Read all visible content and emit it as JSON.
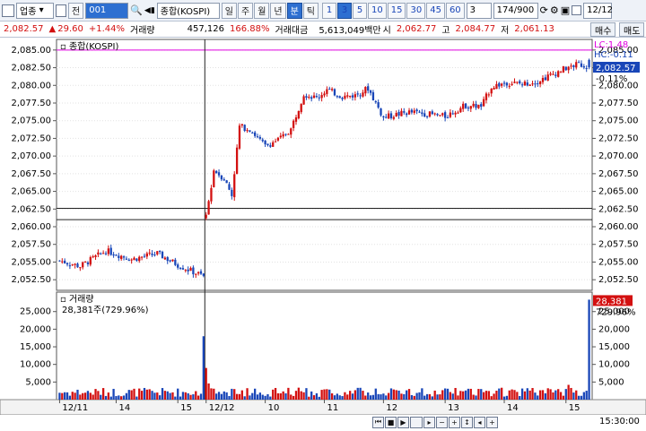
{
  "toolbar": {
    "sector": "업종",
    "mode": "전",
    "code": "001",
    "name": "종합(KOSPI)",
    "periods": [
      "일",
      "주",
      "월",
      "년",
      "분",
      "틱"
    ],
    "active_period": "분",
    "minutes": [
      "1",
      "3",
      "5",
      "10",
      "15",
      "30",
      "45",
      "60"
    ],
    "active_minute": "3",
    "interval": "3",
    "count": "174/900",
    "date": "12/12"
  },
  "quote": {
    "price": "2,082.57",
    "change": "29.60",
    "change_pct": "+1.44%",
    "volume_label": "거래량",
    "volume": "457,126",
    "volume_pct": "166.88%",
    "amount_label": "거래대금",
    "amount": "5,613,049백만",
    "open_label": "시",
    "open": "2,062.77",
    "high_label": "고",
    "high": "2,084.77",
    "low_label": "저",
    "low": "2,061.13",
    "buy": "매수",
    "sell": "매도"
  },
  "price_panel": {
    "title": "종합(KOSPI)",
    "lc": "LC:1.48",
    "hc": "HC:-0.11",
    "current_box": "2,082.57",
    "current_pct": "-0.11%"
  },
  "volume_panel": {
    "title": "거래량",
    "info": "28,381주(729.96%)",
    "current_box": "28,381",
    "current_pct": "729.96%"
  },
  "time_label": "15:30:00",
  "colors": {
    "up": "#d31010",
    "down": "#1946b8",
    "magenta": "#e000e0"
  },
  "chart_data": {
    "type": "candlestick",
    "price_axis": {
      "ticks": [
        "2,085.00",
        "2,082.50",
        "2,080.00",
        "2,077.50",
        "2,075.00",
        "2,072.50",
        "2,070.00",
        "2,067.50",
        "2,065.00",
        "2,062.50",
        "2,060.00",
        "2,057.50",
        "2,055.00",
        "2,052.50"
      ],
      "range": [
        2051.0,
        2086.5
      ]
    },
    "volume_axis": {
      "ticks": [
        "25,000",
        "20,000",
        "15,000",
        "10,000",
        "5,000"
      ],
      "range": [
        0,
        29000
      ]
    },
    "x_labels": [
      "12/11",
      "14",
      "15",
      "12/12",
      "10",
      "11",
      "12",
      "13",
      "14",
      "15"
    ],
    "x_label_index": [
      0,
      22,
      46,
      57,
      80,
      103,
      126,
      150,
      173,
      197
    ],
    "hlines": [
      2085.0,
      2062.6,
      2061.0
    ],
    "vline_index": 56,
    "anchors": [
      [
        0,
        2055.2
      ],
      [
        8,
        2054.4
      ],
      [
        18,
        2056.6
      ],
      [
        28,
        2055.4
      ],
      [
        38,
        2056.2
      ],
      [
        46,
        2054.6
      ],
      [
        52,
        2053.6
      ],
      [
        56,
        2053.0
      ],
      [
        57,
        2061.4
      ],
      [
        60,
        2068.0
      ],
      [
        64,
        2066.8
      ],
      [
        67,
        2064.5
      ],
      [
        70,
        2074.2
      ],
      [
        74,
        2073.8
      ],
      [
        80,
        2071.4
      ],
      [
        86,
        2072.5
      ],
      [
        90,
        2073.8
      ],
      [
        95,
        2078.8
      ],
      [
        100,
        2078.2
      ],
      [
        104,
        2079.4
      ],
      [
        110,
        2078.4
      ],
      [
        115,
        2078.6
      ],
      [
        120,
        2079.6
      ],
      [
        126,
        2075.4
      ],
      [
        130,
        2075.8
      ],
      [
        136,
        2076.2
      ],
      [
        142,
        2076.0
      ],
      [
        150,
        2075.6
      ],
      [
        158,
        2077.2
      ],
      [
        164,
        2077.0
      ],
      [
        168,
        2079.8
      ],
      [
        174,
        2080.4
      ],
      [
        180,
        2080.2
      ],
      [
        186,
        2080.6
      ],
      [
        192,
        2081.6
      ],
      [
        198,
        2082.6
      ],
      [
        202,
        2083.0
      ],
      [
        206,
        2082.6
      ]
    ],
    "vol_spikes": {
      "56": 18000,
      "57": 9000,
      "58": 4600,
      "198": 4200,
      "206": 28381
    },
    "bars": 207
  }
}
